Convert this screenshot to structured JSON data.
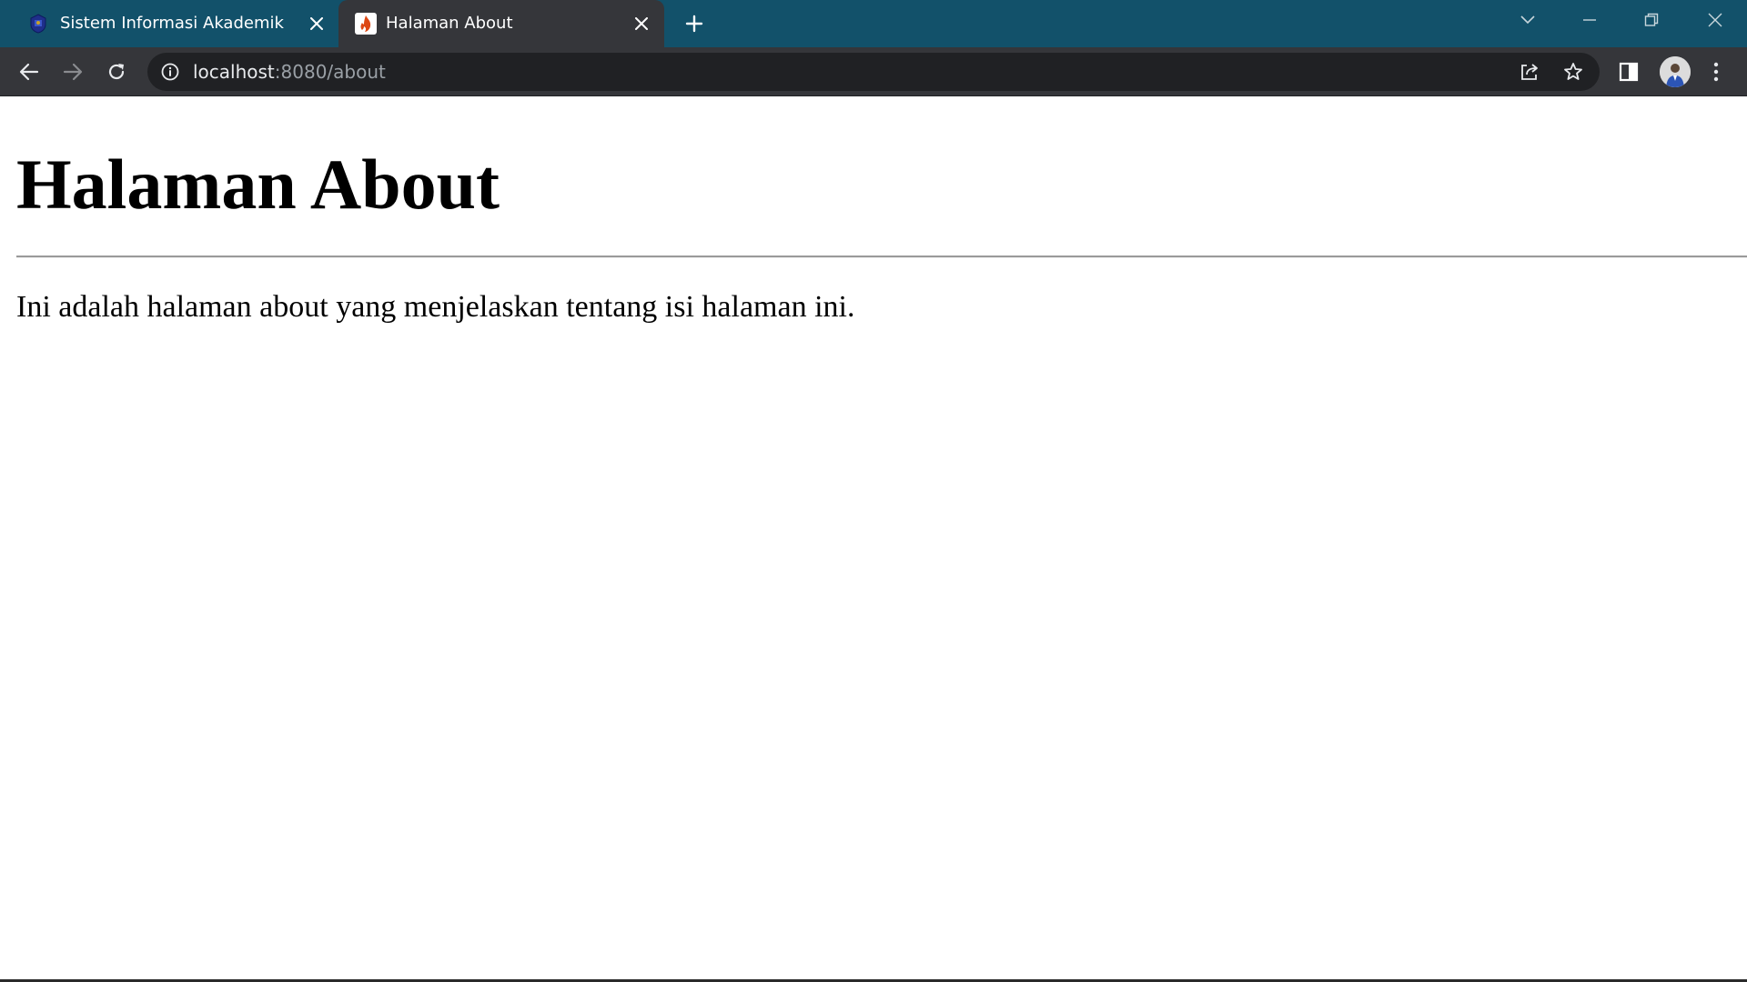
{
  "browser": {
    "tabs": [
      {
        "title": "Sistem Informasi Akademik",
        "active": false,
        "icon": "university-crest-icon"
      },
      {
        "title": "Halaman About",
        "active": true,
        "icon": "codeigniter-flame-icon"
      }
    ],
    "address_bar": {
      "host": "localhost",
      "path": ":8080/about"
    },
    "colors": {
      "titlebar": "#12516a",
      "toolbar": "#35363a",
      "omnibox": "#202124"
    }
  },
  "page": {
    "heading": "Halaman About",
    "paragraph": "Ini adalah halaman about yang menjelaskan tentang isi halaman ini."
  }
}
